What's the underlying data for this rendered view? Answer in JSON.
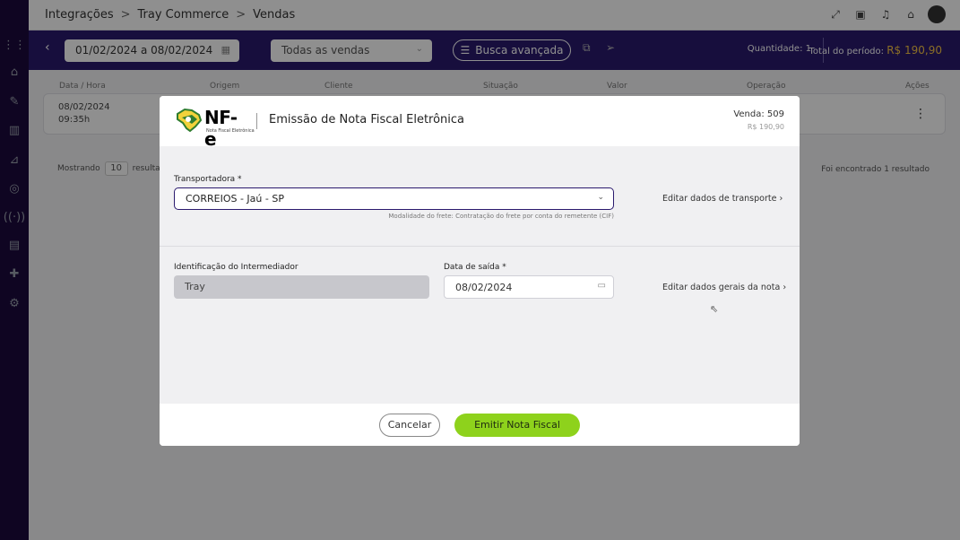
{
  "breadcrumb": {
    "items": [
      "Integrações",
      "Tray Commerce",
      "Vendas"
    ],
    "separator": ">"
  },
  "filter": {
    "date_range": "01/02/2024 a 08/02/2024",
    "sales_select": "Todas as vendas",
    "advanced_search": "Busca avançada",
    "quantity": "Quantidade: 1",
    "total_label": "Total do período:",
    "total_value": "R$ 190,90"
  },
  "table": {
    "headers": [
      "Data / Hora",
      "Origem",
      "Cliente",
      "Situação",
      "Valor",
      "Operação",
      "Ações"
    ],
    "row_date": "08/02/2024",
    "row_time": "09:35h"
  },
  "pagination": {
    "showing": "Mostrando",
    "per_page": "10",
    "results": "resulta",
    "found": "Foi encontrado 1 resultado"
  },
  "modal": {
    "logo_text": "NF-e",
    "logo_subtitle": "Nota Fiscal Eletrônica",
    "title": "Emissão de Nota Fiscal Eletrônica",
    "venda": "Venda: 509",
    "venda_value": "R$ 190,90",
    "transportadora_label": "Transportadora *",
    "transportadora_value": "CORREIOS - Jaú - SP",
    "modalidade": "Modalidade do frete: Contratação do frete por conta do remetente (CIF)",
    "edit_transport": "Editar dados de transporte",
    "intermediador_label": "Identificação do Intermediador",
    "intermediador_value": "Tray",
    "data_saida_label": "Data de saída *",
    "data_saida_value": "08/02/2024",
    "edit_general": "Editar dados gerais da nota",
    "cancel": "Cancelar",
    "emit": "Emitir Nota Fiscal"
  },
  "colors": {
    "primary": "#2a1a6e",
    "sidebar": "#1c0a3d",
    "accent_green": "#8ed21c",
    "total_gold": "#f6c445"
  }
}
